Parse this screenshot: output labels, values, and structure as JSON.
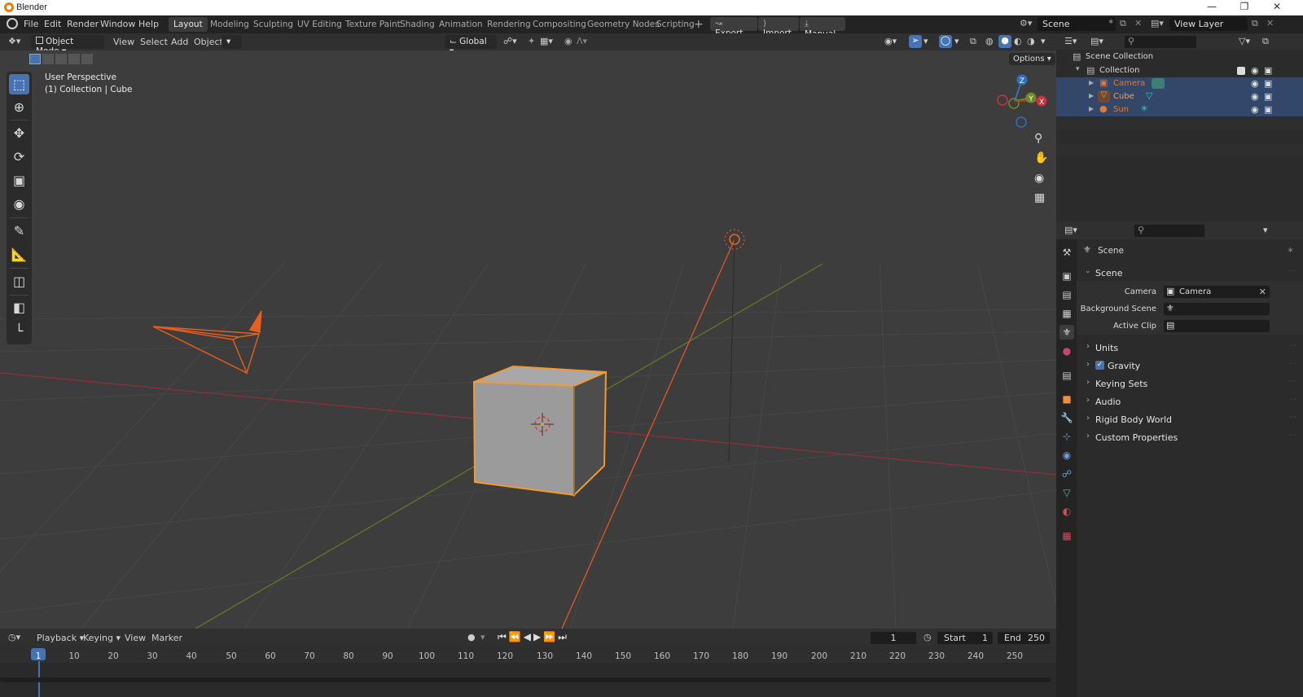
{
  "window": {
    "title": "Blender"
  },
  "menus": [
    "File",
    "Edit",
    "Render",
    "Window",
    "Help"
  ],
  "workspaces": [
    "Layout",
    "Modeling",
    "Sculpting",
    "UV Editing",
    "Texture Paint",
    "Shading",
    "Animation",
    "Rendering",
    "Compositing",
    "Geometry Nodes",
    "Scripting"
  ],
  "active_workspace": "Layout",
  "top_buttons": {
    "export": "Export",
    "import": "Import",
    "manual": "Manual"
  },
  "scene_name": "Scene",
  "view_layer": "View Layer",
  "viewport_header": {
    "mode": "Object Mode",
    "menus": [
      "View",
      "Select",
      "Add",
      "Object"
    ],
    "orientation": "Global",
    "options": "Options"
  },
  "viewport": {
    "view_name": "User Perspective",
    "collection_info": "(1) Collection | Cube",
    "gizmo": {
      "z": "Z",
      "y": "Y",
      "x": "X"
    }
  },
  "outliner": {
    "root": "Scene Collection",
    "collection": "Collection",
    "items": [
      {
        "name": "Camera",
        "color": "#e0793a"
      },
      {
        "name": "Cube",
        "color": "#e0793a"
      },
      {
        "name": "Sun",
        "color": "#e0793a"
      }
    ]
  },
  "properties": {
    "context": "Scene",
    "panel": "Scene",
    "fields": [
      {
        "label": "Camera",
        "value": "Camera"
      },
      {
        "label": "Background Scene",
        "value": ""
      },
      {
        "label": "Active Clip",
        "value": ""
      }
    ],
    "sections": [
      "Units",
      "Gravity",
      "Keying Sets",
      "Audio",
      "Rigid Body World",
      "Custom Properties"
    ]
  },
  "timeline": {
    "menus": [
      "Playback",
      "Keying",
      "View",
      "Marker"
    ],
    "current_frame": "1",
    "start_label": "Start",
    "start": "1",
    "end_label": "End",
    "end": "250",
    "ticks": [
      "1",
      "10",
      "20",
      "30",
      "40",
      "50",
      "60",
      "70",
      "80",
      "90",
      "100",
      "110",
      "120",
      "130",
      "140",
      "150",
      "160",
      "170",
      "180",
      "190",
      "200",
      "210",
      "220",
      "230",
      "240",
      "250"
    ]
  },
  "colors": {
    "selected": "#4772b3",
    "accent": "#e87d0d",
    "x_axis": "#b5323d",
    "y_axis": "#6e8b27",
    "z_axis": "#2f6fc3"
  }
}
